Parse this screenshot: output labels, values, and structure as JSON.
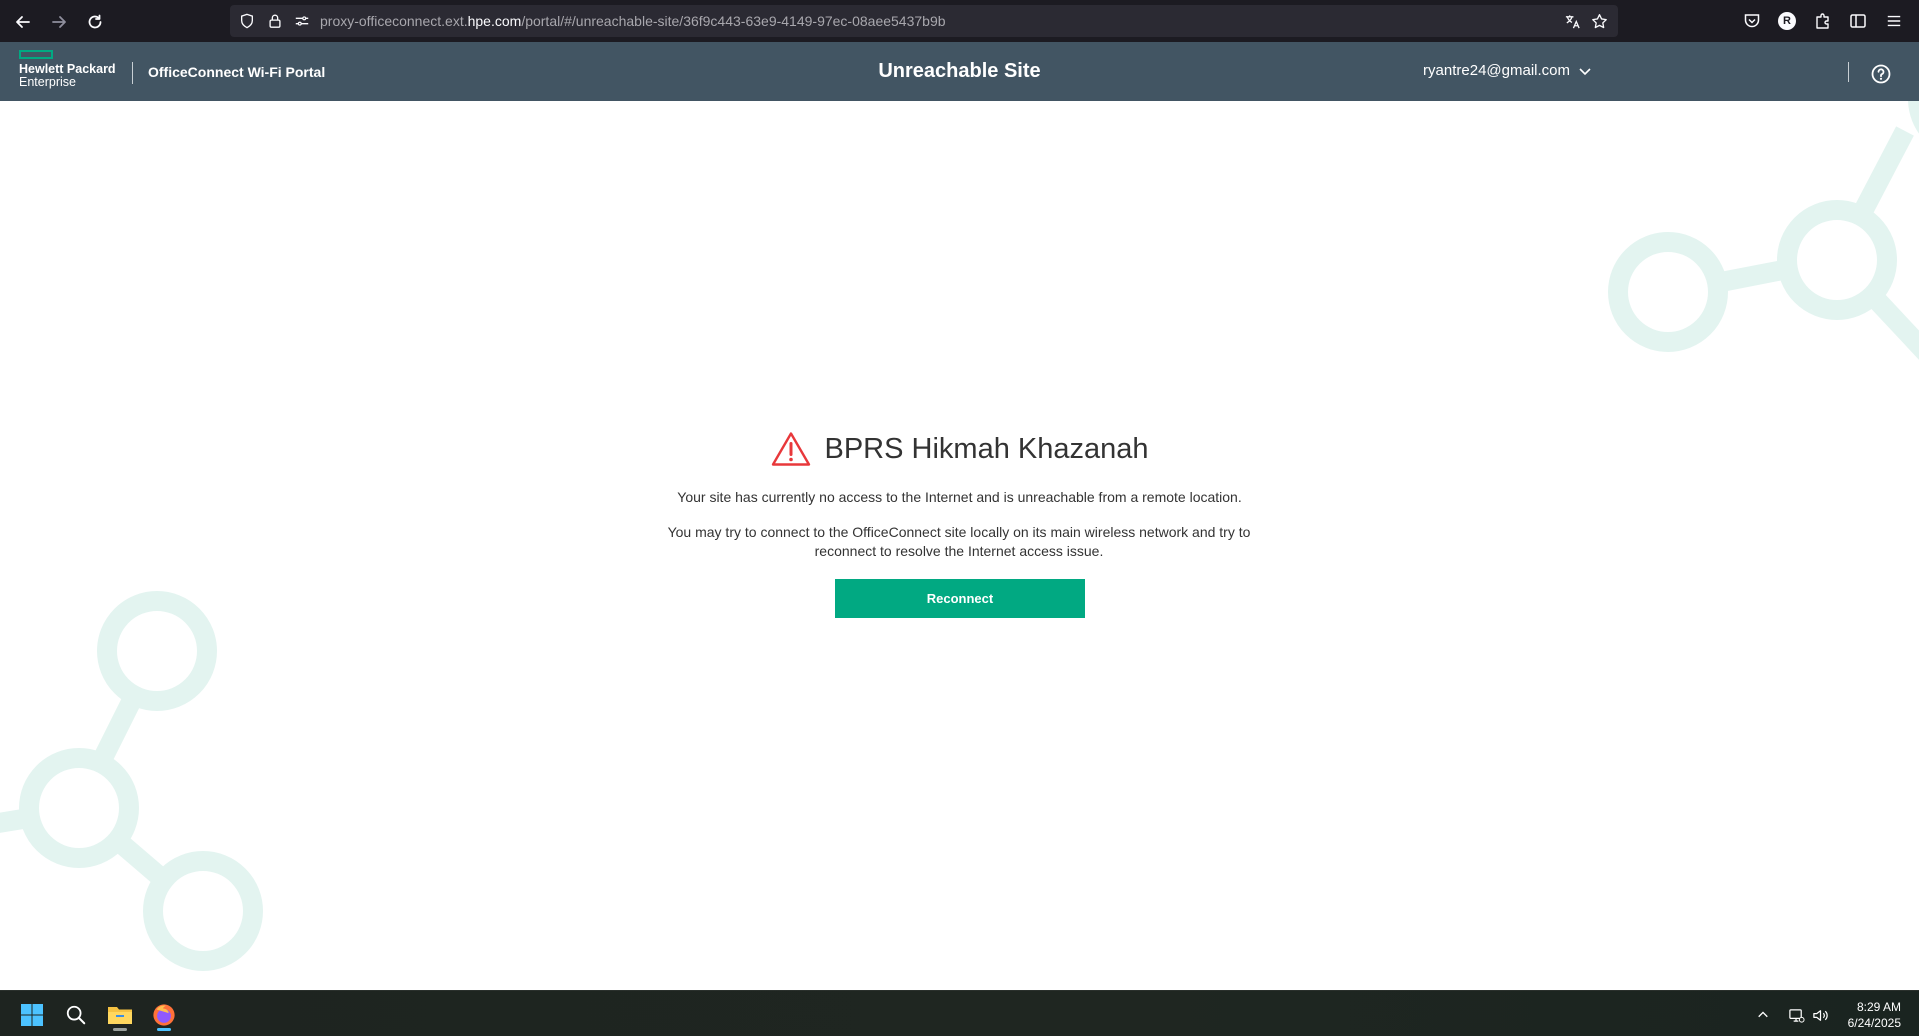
{
  "browser": {
    "url_prefix": "proxy-officeconnect.ext.",
    "url_domain": "hpe.com",
    "url_path": "/portal/#/unreachable-site/36f9c443-63e9-4149-97ec-08aee5437b9b",
    "profile_initial": "R"
  },
  "header": {
    "logo_line1": "Hewlett Packard",
    "logo_line2": "Enterprise",
    "portal_name": "OfficeConnect Wi-Fi Portal",
    "page_title": "Unreachable Site",
    "user_email": "ryantre24@gmail.com"
  },
  "main": {
    "site_name": "BPRS Hikmah Khazanah",
    "message_1": "Your site has currently no access to the Internet and is unreachable from a remote location.",
    "message_2": "You may try to connect to the OfficeConnect site locally on its main wireless network and try to reconnect to resolve the Internet access issue.",
    "reconnect_label": "Reconnect"
  },
  "taskbar": {
    "time": "8:29 AM",
    "date": "6/24/2025"
  },
  "colors": {
    "brand_green": "#01a982",
    "header_bg": "#425563",
    "warning_red": "#e8383b",
    "decoration": "#e3f4f0"
  }
}
